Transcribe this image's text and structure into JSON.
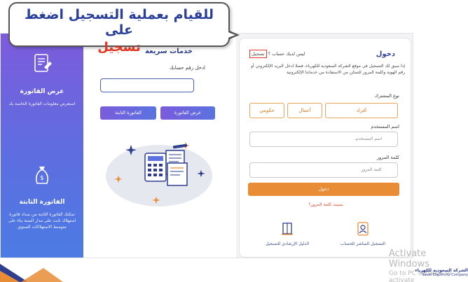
{
  "callout": {
    "line1": "للقيام بعملية التسجيل اضغط على",
    "line2": "تسجيل"
  },
  "sidebar": {
    "bill_view": {
      "title": "عرض الفاتورة",
      "desc": "استعرض معلومات الفاتورة الخاصة بك"
    },
    "prev_bill": {
      "title": "الفاتورة الثابتة",
      "desc": "تمكنك الفاتورة الثابتة من سداد فاتورة استهلاك ثابت على مدار السنة بناء على متوسط الاستهلاكات السنوي"
    }
  },
  "quick_services": {
    "title": "خدمات سريعة",
    "account_label": "ادخل رقم حسابك",
    "account_value": "",
    "btn_view": "عرض الفاتورة",
    "btn_fixed": "الفاتورة الثابتة"
  },
  "login": {
    "title": "دخول",
    "no_account": "ليس لديك حساب ؟",
    "register_link": "تسجيل",
    "intro": "إذا سبق لك التسجيل في موقع الشركة السعودية للكهرباء، فضلا ادخل البريد الإلكتروني أو رقم الهوية وكلمة المرور للتمكن من الاستفادة من خدماتنا الإلكترونية",
    "type_label": "نوع المشترك",
    "types": [
      "أفراد",
      "أعمال",
      "حكومي"
    ],
    "username_label": "اسم المستخدم",
    "username_placeholder": "اسم المستخدم",
    "password_label": "كلمة المرور",
    "password_placeholder": "كلمة المرور",
    "submit": "دخول",
    "forgot": "نسيت كلمة المرور؟",
    "footer_direct": "التسجيل المباشر للحساب",
    "footer_guide": "الدليل الإرشادي للتسجيل"
  },
  "watermark": {
    "line1": "Activate Windows",
    "line2": "Go to PC settings to activate"
  },
  "brand": {
    "arabic": "الشركة السعودية للكهرباء",
    "english": "Saudi Electricity Company"
  },
  "colors": {
    "accent_orange": "#e98c36",
    "brand_blue": "#2f3e8f",
    "highlight_red": "#e03a2b",
    "purple": "#7d5bdc"
  }
}
